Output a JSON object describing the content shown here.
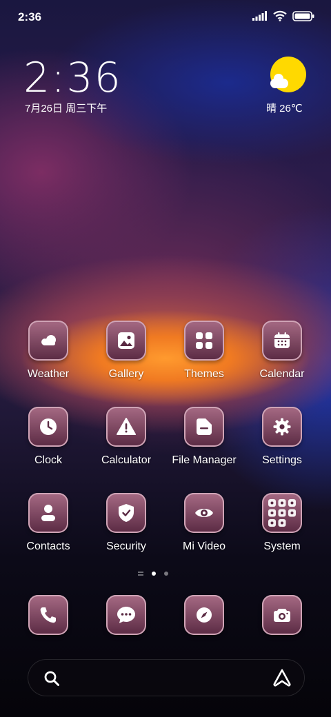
{
  "status_bar": {
    "time": "2:36",
    "icons": [
      "signal-icon",
      "wifi-icon",
      "battery-icon"
    ]
  },
  "clock_widget": {
    "time": "2:36",
    "date": "7月26日 周三下午"
  },
  "weather_widget": {
    "icon": "partly-sunny-icon",
    "text": "晴 26℃"
  },
  "apps": [
    {
      "label": "Weather",
      "icon": "weather-cloud-icon"
    },
    {
      "label": "Gallery",
      "icon": "gallery-icon"
    },
    {
      "label": "Themes",
      "icon": "themes-icon"
    },
    {
      "label": "Calendar",
      "icon": "calendar-icon"
    },
    {
      "label": "Clock",
      "icon": "clock-icon"
    },
    {
      "label": "Calculator",
      "icon": "warning-triangle-icon"
    },
    {
      "label": "File Manager",
      "icon": "folder-icon"
    },
    {
      "label": "Settings",
      "icon": "gear-icon"
    },
    {
      "label": "Contacts",
      "icon": "person-icon"
    },
    {
      "label": "Security",
      "icon": "shield-check-icon"
    },
    {
      "label": "Mi Video",
      "icon": "eye-icon"
    },
    {
      "label": "System",
      "icon": "folder-grid-icon"
    }
  ],
  "page_indicator": {
    "pages": 2,
    "current": 1
  },
  "dock": [
    {
      "icon": "phone-icon"
    },
    {
      "icon": "message-icon"
    },
    {
      "icon": "compass-icon"
    },
    {
      "icon": "camera-icon"
    }
  ],
  "search_bar": {
    "left_icon": "search-icon",
    "right_icon": "assistant-icon"
  }
}
